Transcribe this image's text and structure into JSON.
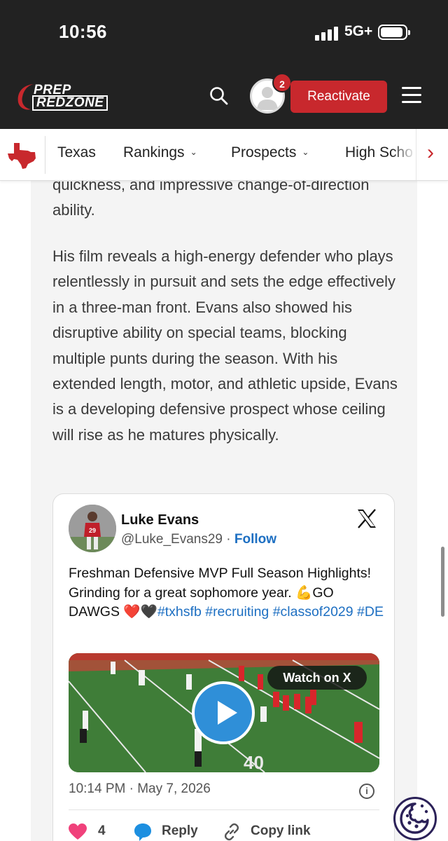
{
  "status_bar": {
    "time": "10:56",
    "network": "5G+",
    "battery_level": 0.9
  },
  "header": {
    "logo_top": "PREP",
    "logo_bottom": "REDZONE",
    "notification_count": "2",
    "reactivate_label": "Reactivate"
  },
  "nav": {
    "items": [
      {
        "label": "Texas"
      },
      {
        "label": "Rankings"
      },
      {
        "label": "Prospects"
      },
      {
        "label": "High Scho"
      }
    ]
  },
  "article": {
    "fragment": "quickness, and impressive change-of-direction ability.",
    "paragraph": "His film reveals a high-energy defender who plays relentlessly in pursuit and sets the edge effectively in a three-man front. Evans also showed his disruptive ability on special teams, blocking multiple punts during the season. With his extended length, motor, and athletic upside, Evans is a developing defensive prospect whose ceiling will  rise as he matures physically."
  },
  "post": {
    "name": "Luke Evans",
    "handle": "@Luke_Evans29",
    "separator": "·",
    "follow_label": "Follow",
    "text_plain": "Freshman Defensive MVP Full Season Highlights! Grinding for a great sophomore year. 💪GO DAWGS ❤️🖤",
    "hashtags": [
      "#txhsfb",
      "#recruiting",
      "#classof2029",
      "#DE"
    ],
    "video_badge": "Watch on X",
    "timestamp": "10:14 PM · May 7, 2026",
    "like_count": "4",
    "reply_label": "Reply",
    "copy_link_label": "Copy link"
  },
  "colors": {
    "brand_red": "#c8282d",
    "link_blue": "#1d6fc2",
    "header_bg": "#222222",
    "cookie_purple": "#2b2158"
  },
  "icons": [
    "search-icon",
    "avatar-placeholder",
    "menu-icon",
    "texas-state-icon",
    "chevron-down-icon",
    "chevron-right-icon",
    "x-logo-icon",
    "play-icon",
    "info-icon",
    "heart-icon",
    "reply-icon",
    "link-icon",
    "cookie-icon"
  ]
}
